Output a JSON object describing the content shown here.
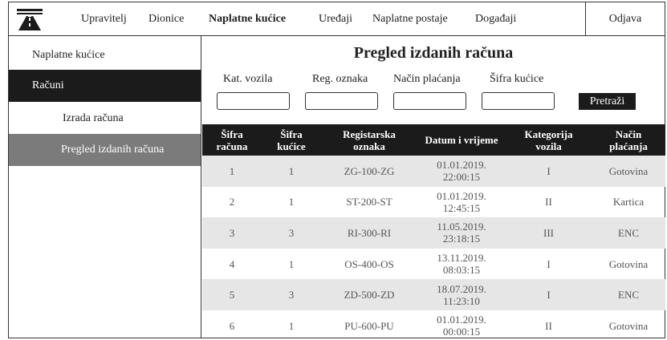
{
  "nav": {
    "items": [
      {
        "label": "Upravitelj"
      },
      {
        "label": "Dionice"
      },
      {
        "label": "Naplatne kućice"
      },
      {
        "label": "Uređaji"
      },
      {
        "label": "Naplatne postaje"
      },
      {
        "label": "Događaji"
      }
    ],
    "active": "Naplatne kućice",
    "logout": "Odjava"
  },
  "sidebar": {
    "items": [
      {
        "label": "Naplatne kućice"
      },
      {
        "label": "Računi"
      },
      {
        "label": "Izrada računa"
      },
      {
        "label": "Pregled izdanih računa"
      }
    ]
  },
  "main": {
    "title": "Pregled izdanih računa",
    "filters": [
      {
        "label": "Kat. vozila",
        "value": ""
      },
      {
        "label": "Reg. oznaka",
        "value": ""
      },
      {
        "label": "Način plaćanja",
        "value": ""
      },
      {
        "label": "Šifra kućice",
        "value": ""
      }
    ],
    "search_label": "Pretraži",
    "table": {
      "headers": [
        [
          "Šifra",
          "računa"
        ],
        [
          "Šifra",
          "kućice"
        ],
        [
          "Registarska",
          "oznaka"
        ],
        [
          "Datum i vrijeme",
          ""
        ],
        [
          "Kategorija",
          "vozila"
        ],
        [
          "Način",
          "plaćanja"
        ]
      ],
      "rows": [
        [
          "1",
          "1",
          "ZG-100-ZG",
          "01.01.2019.",
          "22:00:15",
          "I",
          "Gotovina"
        ],
        [
          "2",
          "1",
          "ST-200-ST",
          "01.01.2019.",
          "12:45:15",
          "II",
          "Kartica"
        ],
        [
          "3",
          "3",
          "RI-300-RI",
          "11.05.2019.",
          "23:18:15",
          "III",
          "ENC"
        ],
        [
          "4",
          "1",
          "OS-400-OS",
          "13.11.2019.",
          "08:03:15",
          "I",
          "Gotovina"
        ],
        [
          "5",
          "3",
          "ZD-500-ZD",
          "18.07.2019.",
          "11:23:10",
          "I",
          "ENC"
        ],
        [
          "6",
          "1",
          "PU-600-PU",
          "01.01.2019.",
          "00:00:15",
          "II",
          "Gotovina"
        ]
      ]
    }
  },
  "colors": {
    "dark": "#1b1b1b",
    "selected": "#7b7b7b",
    "row_alt": "#e6e6e6"
  },
  "icons": {
    "logo": "highway-icon"
  }
}
